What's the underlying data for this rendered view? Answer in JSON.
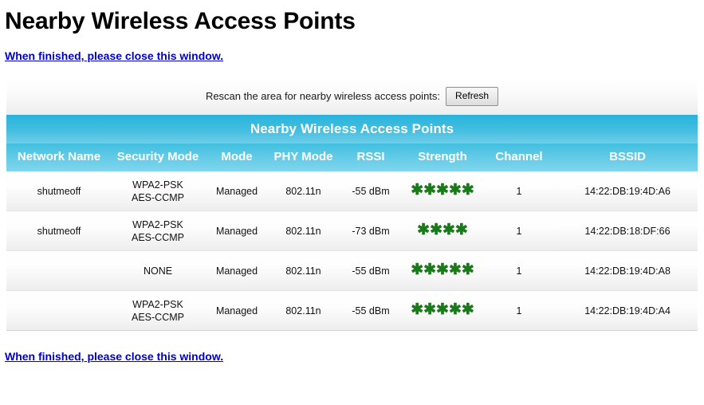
{
  "page": {
    "title": "Nearby Wireless Access Points",
    "close_link_top": "When finished, please close this window.",
    "close_link_bottom": "When finished, please close this window."
  },
  "rescan": {
    "label": "Rescan the area for nearby wireless access points:",
    "button_label": "Refresh"
  },
  "table": {
    "caption": "Nearby Wireless Access Points",
    "headers": {
      "network_name": "Network\nName",
      "security_mode": "Security\nMode",
      "mode": "Mode",
      "phy_mode": "PHY\nMode",
      "rssi": "RSSI",
      "strength": "Strength",
      "channel": "Channel",
      "bssid": "BSSID"
    },
    "rows": [
      {
        "network_name": "shutmeoff",
        "security_mode": "WPA2-PSK\nAES-CCMP",
        "mode": "Managed",
        "phy_mode": "802.11n",
        "rssi": "-55 dBm",
        "strength": "✱✱✱✱✱",
        "strength_count": 5,
        "channel": "1",
        "bssid": "14:22:DB:19:4D:A6"
      },
      {
        "network_name": "shutmeoff",
        "security_mode": "WPA2-PSK\nAES-CCMP",
        "mode": "Managed",
        "phy_mode": "802.11n",
        "rssi": "-73 dBm",
        "strength": "✱✱✱✱",
        "strength_count": 4,
        "channel": "1",
        "bssid": "14:22:DB:18:DF:66"
      },
      {
        "network_name": "",
        "security_mode": "NONE",
        "mode": "Managed",
        "phy_mode": "802.11n",
        "rssi": "-55 dBm",
        "strength": "✱✱✱✱✱",
        "strength_count": 5,
        "channel": "1",
        "bssid": "14:22:DB:19:4D:A8"
      },
      {
        "network_name": "",
        "security_mode": "WPA2-PSK\nAES-CCMP",
        "mode": "Managed",
        "phy_mode": "802.11n",
        "rssi": "-55 dBm",
        "strength": "✱✱✱✱✱",
        "strength_count": 5,
        "channel": "1",
        "bssid": "14:22:DB:19:4D:A4"
      }
    ]
  },
  "colors": {
    "header_cyan": "#41bfe0",
    "caption_cyan": "#29b3dd",
    "link_blue": "#0000cc",
    "star_green": "#1a7a1a"
  }
}
